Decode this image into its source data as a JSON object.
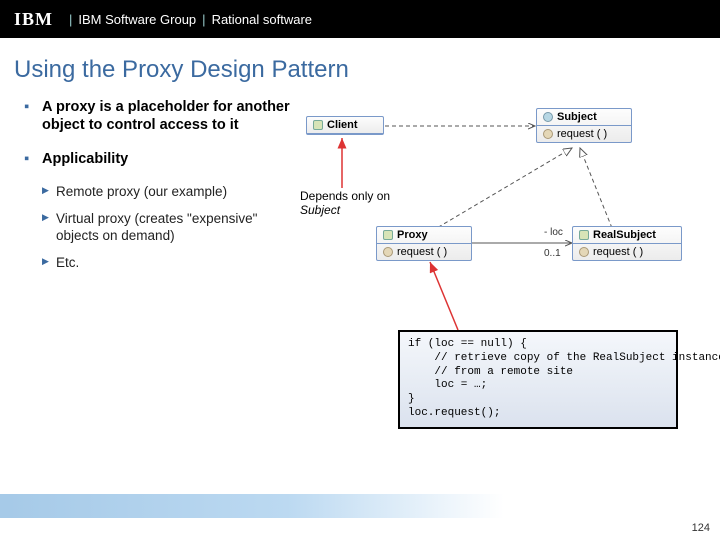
{
  "header": {
    "brand": "IBM",
    "group": "IBM Software Group",
    "product": "Rational software",
    "sep": "|"
  },
  "title": "Using the Proxy Design Pattern",
  "bullets": {
    "b1a": "A proxy is a placeholder for another object to control access to it",
    "b1b": "Applicability",
    "b2a": "Remote proxy (our example)",
    "b2b": "Virtual proxy (creates \"expensive\" objects on demand)",
    "b2c": "Etc."
  },
  "note": {
    "line1": "Depends only on",
    "line2": "Subject"
  },
  "roles": {
    "loc": "- loc",
    "mult": "0..1"
  },
  "uml": {
    "client": "Client",
    "subject": "Subject",
    "proxy": "Proxy",
    "real": "RealSubject",
    "request": "request ( )"
  },
  "code": "if (loc == null) {\n    // retrieve copy of the RealSubject instance\n    // from a remote site\n    loc = …;\n}\nloc.request();",
  "pagenum": "124"
}
